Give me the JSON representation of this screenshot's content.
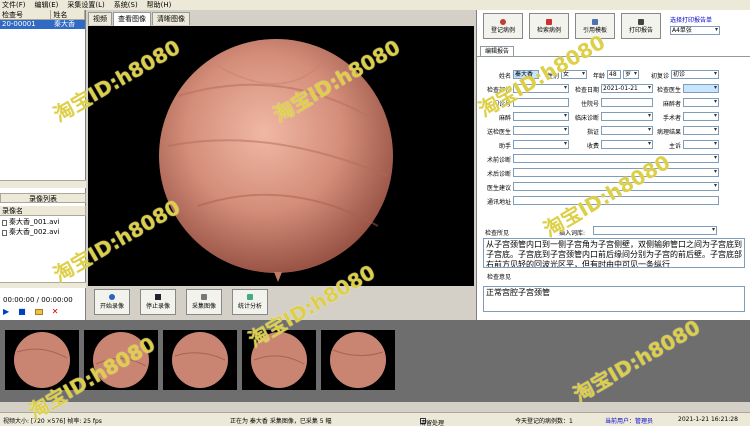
{
  "menu": [
    "文件(F)",
    "编辑(E)",
    "采集设置(L)",
    "系统(S)",
    "帮助(H)"
  ],
  "patient_grid": {
    "col_id": "检查号",
    "col_name": "姓名",
    "rows": [
      {
        "id": "20-00001",
        "name": "秦大香"
      }
    ]
  },
  "recordings": {
    "title": "录像列表",
    "header": "录像名",
    "items": [
      "秦大香_001.avi",
      "秦大香_002.avi"
    ]
  },
  "playback": {
    "time": "00:00:00 / 00:00:00"
  },
  "center_tabs": [
    "视频",
    "查看图像",
    "清晰图像"
  ],
  "controls": {
    "record": "开始录像",
    "stop": "停止录像",
    "capture": "采集图像",
    "stats": "统计分析"
  },
  "toolbar": {
    "register": "登记病例",
    "search": "检索病例",
    "template": "引用模板",
    "print": "打印报告",
    "print_select_label": "选择打印报告单",
    "print_select_value": "A4单张"
  },
  "report_tab": "编辑报告",
  "form": {
    "name_label": "姓名",
    "name_value": "秦大香",
    "sex_label": "性别",
    "sex_value": "女",
    "age_label": "年龄",
    "age_value": "48",
    "age_unit": "岁",
    "visit_label": "初复诊",
    "visit_value": "初诊",
    "part_label": "检查部位",
    "date_label": "检查日期",
    "date_value": "2021-01-21",
    "doctor_label": "检查医生",
    "outpatient_label": "门诊号",
    "inpatient_label": "住院号",
    "anes_label": "麻醉者",
    "anesthesia_label": "麻醉",
    "clinical_label": "临床诊断",
    "operator_label": "手术者",
    "referral_label": "送检医生",
    "indication_label": "指证",
    "pathology_label": "病理结果",
    "assistant_label": "助手",
    "fee_label": "收费",
    "complaint_label": "主诉",
    "preop_label": "术前诊断",
    "postop_label": "术后诊断",
    "advice_label": "医生建议",
    "address_label": "通讯地址"
  },
  "findings": {
    "label": "检查所见",
    "insert_label": "插入词库:",
    "text": "从子宫颈管内口到一侧子宫角为子宫侧壁，双侧输卵管口之间为子宫底到子宫底。子宫底到子宫颈管内口前后缘间分别为子宫的前后壁。子宫底部右前方见轻的回波光区平，但有时由中可见一条纵行"
  },
  "opinion": {
    "label": "检查意见",
    "text": "正常宫腔子宫颈管"
  },
  "status": {
    "video_size": "视频大小: [720 ×576]  帧率: 25 fps",
    "capturing": "正在为 秦大香 采集图像，已采集 5 幅",
    "clear_label": "清留处理",
    "registered": "今天登记的病例数：1",
    "user": "当前用户：管理员",
    "datetime": "2021-1-21 16:21:28"
  },
  "watermark": "淘宝ID:h8080",
  "colors": {
    "selection": "#316ac5",
    "field_highlight": "#c7e5ff",
    "accent_blue": "#0000cc"
  }
}
